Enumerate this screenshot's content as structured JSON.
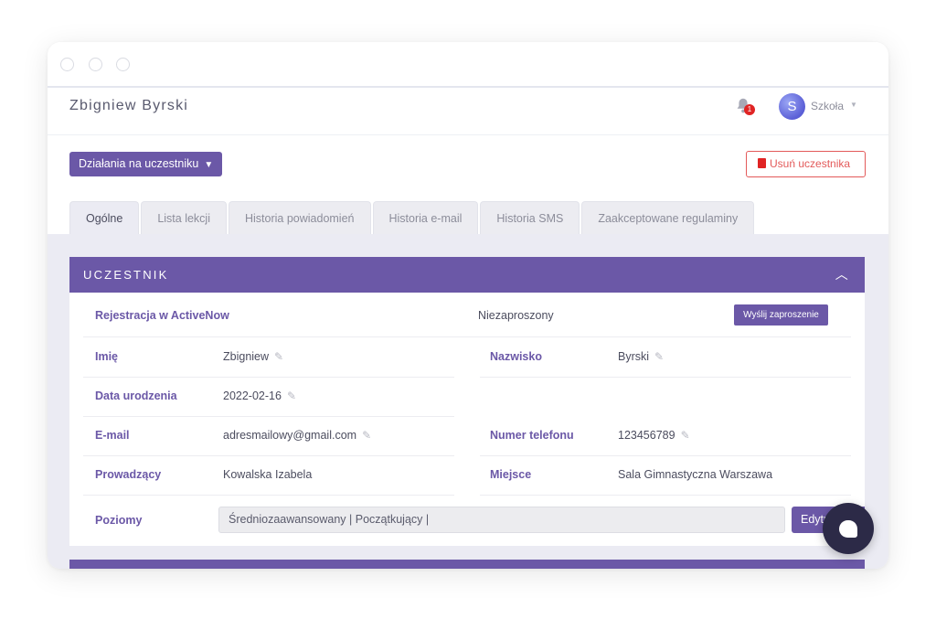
{
  "header": {
    "title": "Zbigniew Byrski",
    "notification_count": "1",
    "avatar_letter": "S",
    "user_label": "Szkoła"
  },
  "toolbar": {
    "actions_label": "Działania na uczestniku",
    "delete_label": "Usuń uczestnika"
  },
  "tabs": [
    {
      "label": "Ogólne",
      "active": true
    },
    {
      "label": "Lista lekcji"
    },
    {
      "label": "Historia powiadomień"
    },
    {
      "label": "Historia e-mail"
    },
    {
      "label": "Historia SMS"
    },
    {
      "label": "Zaakceptowane regulaminy"
    }
  ],
  "participant": {
    "section_title": "UCZESTNIK",
    "registration_label": "Rejestracja w ActiveNow",
    "registration_value": "Niezaproszony",
    "invite_button": "Wyślij zaproszenie",
    "first_name_label": "Imię",
    "first_name": "Zbigniew",
    "last_name_label": "Nazwisko",
    "last_name": "Byrski",
    "birth_date_label": "Data urodzenia",
    "birth_date": "2022-02-16",
    "email_label": "E-mail",
    "email": "adresmailowy@gmail.com",
    "phone_label": "Numer telefonu",
    "phone": "123456789",
    "instructor_label": "Prowadzący",
    "instructor": "Kowalska Izabela",
    "place_label": "Miejsce",
    "place": "Sala Gimnastyczna Warszawa",
    "levels_label": "Poziomy",
    "levels": "Średniozaawansowany | Początkujący |",
    "edit_button": "Edytu"
  },
  "colors": {
    "accent": "#6b58a7",
    "danger": "#e02424",
    "chat": "#2c2a47"
  }
}
